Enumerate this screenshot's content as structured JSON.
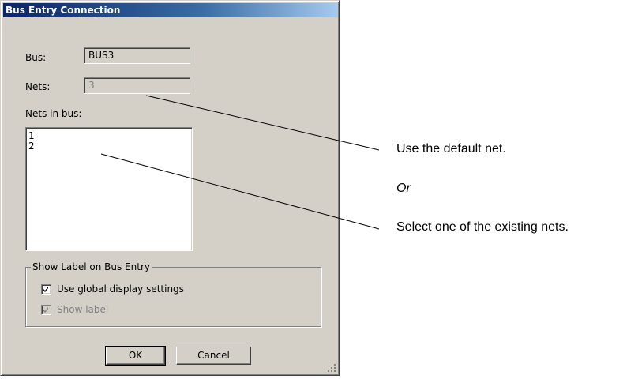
{
  "dialog": {
    "title": "Bus Entry Connection",
    "bus_label": "Bus:",
    "bus_value": "BUS3",
    "nets_label": "Nets:",
    "nets_value": "3",
    "nets_in_bus_label": "Nets in bus:",
    "nets_in_bus_items": [
      "1",
      "2"
    ],
    "group_title": "Show Label on Bus Entry",
    "use_global_label": "Use global display settings",
    "use_global_checked": true,
    "show_label_label": "Show label",
    "show_label_checked": true,
    "ok_label": "OK",
    "cancel_label": "Cancel"
  },
  "annotations": {
    "default_net": "Use the default net.",
    "or": "Or",
    "select_existing": "Select one of the existing nets."
  }
}
